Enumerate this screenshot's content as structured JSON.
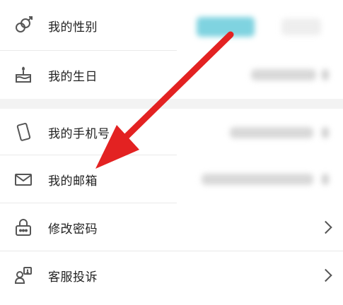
{
  "rows": [
    {
      "label": "我的性别",
      "icon": "gender-icon"
    },
    {
      "label": "我的生日",
      "icon": "cake-icon"
    },
    {
      "label": "我的手机号",
      "icon": "phone-icon"
    },
    {
      "label": "我的邮箱",
      "icon": "mail-icon"
    },
    {
      "label": "修改密码",
      "icon": "lock-icon"
    },
    {
      "label": "客服投诉",
      "icon": "support-icon"
    }
  ],
  "colors": {
    "accent": "#7fd3e0",
    "arrow": "#e32222"
  }
}
